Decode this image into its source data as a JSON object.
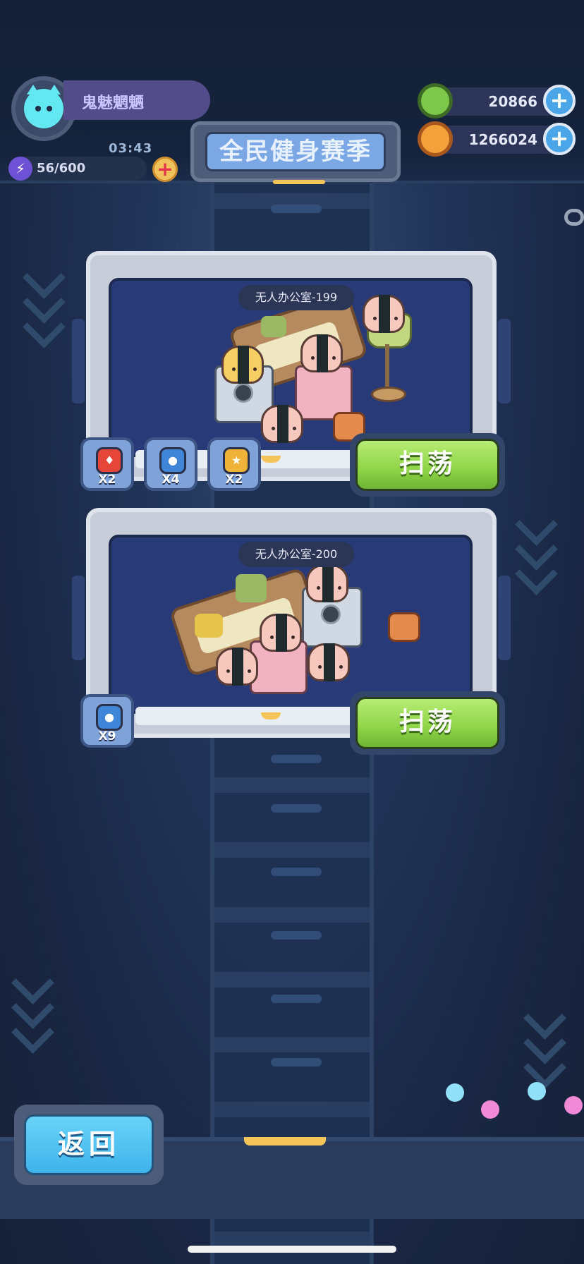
{
  "player": {
    "name": "鬼魅魍魉",
    "timer": "03:43",
    "energy": "56/600"
  },
  "event": {
    "title": "全民健身赛季"
  },
  "currency": [
    {
      "icon": "green-gem-ring-icon",
      "value": "20866"
    },
    {
      "icon": "gold-planet-coin-icon",
      "value": "1266024"
    }
  ],
  "levels": [
    {
      "title": "无人办公室-199",
      "rewards": [
        {
          "icon": "red-fire-gem-icon",
          "color": "#e6463a",
          "qty": "X2"
        },
        {
          "icon": "blue-water-gem-icon",
          "color": "#3f86d8",
          "qty": "X4"
        },
        {
          "icon": "gold-star-gem-icon",
          "color": "#f0b33a",
          "qty": "X2"
        }
      ],
      "action": "扫荡"
    },
    {
      "title": "无人办公室-200",
      "rewards": [
        {
          "icon": "blue-water-gem-icon",
          "color": "#3f86d8",
          "qty": "X9"
        }
      ],
      "action": "扫荡"
    }
  ],
  "footer": {
    "back_label": "返回"
  },
  "symbols": {
    "plus": "+",
    "bolt": "⚡",
    "fire": "♦",
    "drop": "●",
    "star": "★"
  }
}
